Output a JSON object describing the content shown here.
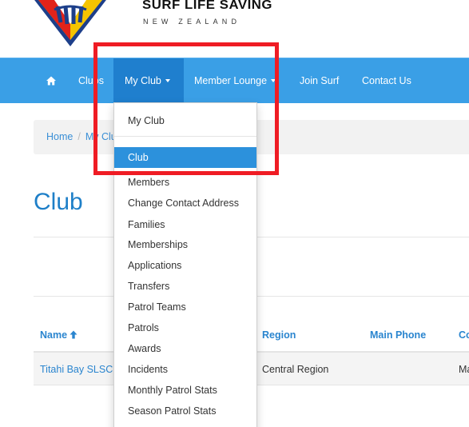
{
  "brand": {
    "name": "SURF LIFE SAVING",
    "country": "NEW ZEALAND",
    "logo_icon": "slsnz-shield-logo"
  },
  "nav": {
    "home_icon": "home-icon",
    "items": [
      {
        "label": "Clubs",
        "dropdown": false
      },
      {
        "label": "My Club",
        "dropdown": true,
        "active": true
      },
      {
        "label": "Member Lounge",
        "dropdown": true
      },
      {
        "label": "Join Surf",
        "dropdown": false
      },
      {
        "label": "Contact Us",
        "dropdown": false
      }
    ]
  },
  "breadcrumb": {
    "home": "Home",
    "separator": "/",
    "current": "My Club"
  },
  "page": {
    "title": "Club"
  },
  "dropdown": {
    "header_item": "My Club",
    "items": [
      "Club",
      "Members",
      "Change Contact Address",
      "Families",
      "Memberships",
      "Applications",
      "Transfers",
      "Patrol Teams",
      "Patrols",
      "Awards",
      "Incidents",
      "Monthly Patrol Stats",
      "Season Patrol Stats"
    ],
    "highlighted": "Club"
  },
  "table": {
    "columns": [
      "Name",
      "Region",
      "Main Phone",
      "Co"
    ],
    "sort_icon": "arrow-up-icon",
    "rows": [
      {
        "name": "Titahi Bay SLSC",
        "region": "Central Region",
        "main_phone": "",
        "co": "Ma"
      }
    ]
  },
  "colors": {
    "nav_bg": "#3a9fe6",
    "nav_active": "#1f7fce",
    "link": "#2a85cf",
    "highlight": "#2c91dc",
    "annotation": "#ef1c24"
  }
}
